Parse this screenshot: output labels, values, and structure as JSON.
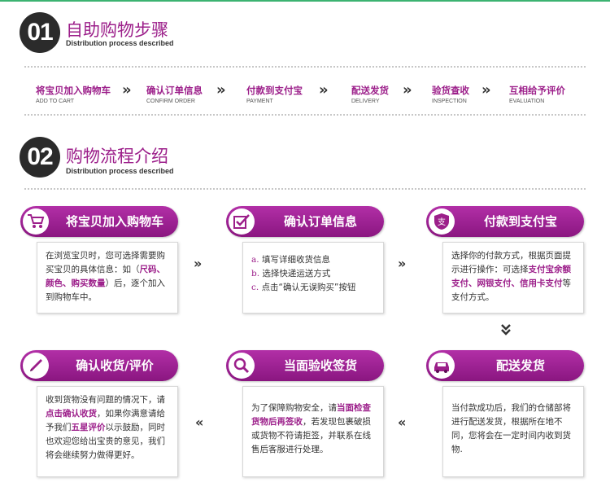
{
  "section1": {
    "number": "01",
    "title": "自助购物步骤",
    "subtitle": "Distribution process described",
    "steps": [
      {
        "cn": "将宝贝加入购物车",
        "en": "ADD TO CART"
      },
      {
        "cn": "确认订单信息",
        "en": "CONFIRM ORDER"
      },
      {
        "cn": "付款到支付宝",
        "en": "PAYMENT"
      },
      {
        "cn": "配送发货",
        "en": "DELIVERY"
      },
      {
        "cn": "验货查收",
        "en": "INSPECTION"
      },
      {
        "cn": "互相给予评价",
        "en": "EVALUATION"
      }
    ],
    "arrow": "»"
  },
  "section2": {
    "number": "02",
    "title": "购物流程介绍",
    "subtitle": "Distribution process described",
    "cards": {
      "cart": {
        "title": "将宝贝加入购物车",
        "icon": "shopping-cart-icon",
        "parts": [
          "在浏览宝贝时，您可选择需要购买宝贝的具体信息：如（",
          "尺码、颜色、购买数量",
          "）后，逐个加入到购物车中。"
        ]
      },
      "order": {
        "title": "确认订单信息",
        "icon": "checkmark-icon",
        "items": [
          {
            "marker": "a.",
            "text": "填写详细收货信息"
          },
          {
            "marker": "b.",
            "text": "选择快递运送方式"
          },
          {
            "marker": "c.",
            "text": "点击“确认无误购买”按钮"
          }
        ]
      },
      "pay": {
        "title": "付款到支付宝",
        "icon": "alipay-shield-icon",
        "parts": [
          "选择你的付款方式，根据页面提示进行操作：可选择",
          "支付宝余额支付、网银支付、信用卡支付",
          "等支付方式。"
        ]
      },
      "delivery": {
        "title": "配送发货",
        "icon": "car-icon",
        "text": "当付款成功后，我们的仓储部将进行配送发货，根据所在地不同，您将会在一定时间内收到货物."
      },
      "inspect": {
        "title": "当面验收签货",
        "icon": "magnifier-icon",
        "parts": [
          "为了保障购物安全，请",
          "当面检查货物后再签收",
          "，若发现包裹破损或货物不符请拒签，并联系在线售后客服进行处理。"
        ]
      },
      "review": {
        "title": "确认收货/评价",
        "icon": "pen-icon",
        "parts": [
          "收到货物没有问题的情况下，请",
          "点击确认收货",
          "，如果你满意请给予我们",
          "五星评价",
          "以示鼓励，同时也欢迎您给出宝贵的意见，我们将会继续努力做得更好。"
        ]
      }
    },
    "arrow_right": "»",
    "arrow_left": "«"
  },
  "colors": {
    "accent": "#9c1f8a",
    "badge": "#2b2b2b",
    "top_line": "#3cb371"
  }
}
